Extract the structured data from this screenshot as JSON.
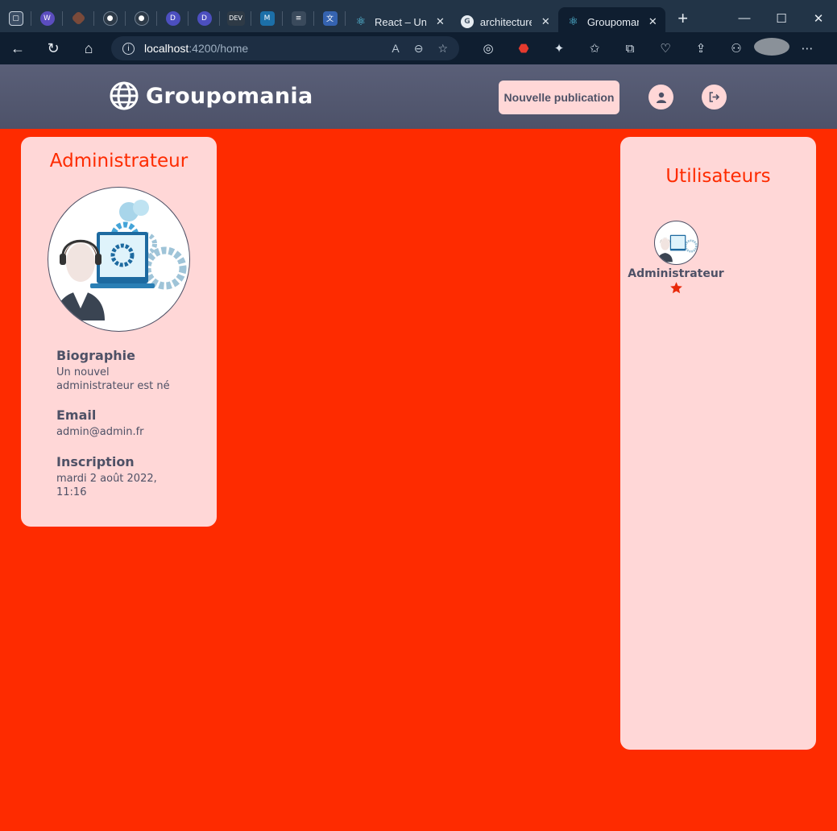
{
  "browser": {
    "pinned_tabs": [
      {
        "icon": "tab-actions-icon",
        "color": "#3a4c63"
      },
      {
        "icon": "w-icon",
        "color": "#5b4dbe"
      },
      {
        "icon": "git-diamond-icon",
        "color": "#7a4a3a"
      },
      {
        "icon": "github-icon",
        "color": "#2d3a48"
      },
      {
        "icon": "github-icon",
        "color": "#2d3a48"
      },
      {
        "icon": "d-icon",
        "color": "#4c4fbf"
      },
      {
        "icon": "d-icon",
        "color": "#4c4fbf"
      },
      {
        "icon": "dev-icon",
        "color": "#2e3a46"
      },
      {
        "icon": "m-icon",
        "color": "#1c6fa8"
      },
      {
        "icon": "stack-icon",
        "color": "#3a4a5c"
      },
      {
        "icon": "translate-icon",
        "color": "#3563b0"
      }
    ],
    "tabs": [
      {
        "label": "React – Une",
        "icon": "react-icon",
        "active": false
      },
      {
        "label": "architecture",
        "icon": "google-icon",
        "active": false
      },
      {
        "label": "Groupomania",
        "icon": "react-icon",
        "active": true
      }
    ],
    "url_host": "localhost",
    "url_path": ":4200/home"
  },
  "header": {
    "brand": "Groupomania",
    "new_post_label": "Nouvelle publication"
  },
  "profile": {
    "name": "Administrateur",
    "bio_label": "Biographie",
    "bio": "Un nouvel administrateur est né",
    "email_label": "Email",
    "email": "admin@admin.fr",
    "signup_label": "Inscription",
    "signup": "mardi 2 août 2022, 11:16"
  },
  "users_panel": {
    "title": "Utilisateurs",
    "users": [
      {
        "name": "Administrateur",
        "admin": true
      }
    ]
  },
  "colors": {
    "page_bg": "#fe2b00",
    "card_bg": "#ffd7d7",
    "text": "#4e5166",
    "header_bg": "#4e5166"
  }
}
